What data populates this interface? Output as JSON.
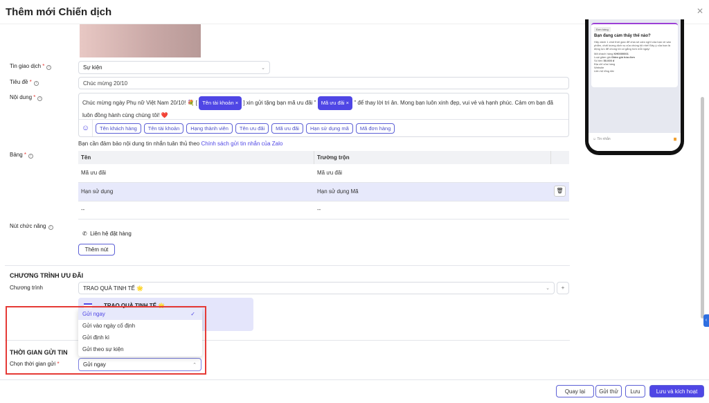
{
  "title": "Thêm mới Chiến dịch",
  "form": {
    "transaction_label": "Tin giao dịch",
    "transaction_value": "Sự kiện",
    "subject_label": "Tiêu đề",
    "subject_value": "Chúc mừng 20/10",
    "content_label": "Nội dung",
    "content_part1": "Chúc mừng ngày Phụ nữ Việt Nam 20/10! 💐 [",
    "tag_account": "Tên tài khoản",
    "content_part2": "] xin gửi tặng bạn mã ưu đãi \"",
    "tag_code": "Mã ưu đãi",
    "content_part3": "\" để thay lời tri ân. Mong bạn luôn xinh đẹp, vui vẻ và hạnh phúc. Cảm ơn bạn đã luôn đồng hành cùng chúng tôi! ❤️",
    "chips": [
      "Tên khách hàng",
      "Tên tài khoản",
      "Hạng thành viên",
      "Tên ưu đãi",
      "Mã ưu đãi",
      "Hạn sử dụng mã",
      "Mã đơn hàng"
    ],
    "note": "Bạn cần đảm bảo nội dung tin nhắn tuân thủ theo ",
    "note_link": "Chính sách gửi tin nhắn của Zalo",
    "table_label": "Bảng",
    "table_headers": [
      "Tên",
      "Trường trộn"
    ],
    "table_rows": [
      [
        "Mã ưu đãi",
        "Mã ưu đãi"
      ],
      [
        "Hạn sử dụng",
        "Hạn sử dụng Mã"
      ],
      [
        "--",
        "--"
      ]
    ],
    "button_label": "Nút chức năng",
    "button_item": "Liên hệ đặt hàng",
    "add_button": "Thêm nút"
  },
  "promo": {
    "heading": "CHƯƠNG TRÌNH ƯU ĐÃI",
    "program_label": "Chương trình",
    "program_value": "TRAO QUÀ TINH TẾ 🌟",
    "card_title": "TRAO QUÀ TINH TẾ 🌟"
  },
  "send_time": {
    "heading": "THỜI GIAN GỬI TIN",
    "label": "Chọn thời gian gửi",
    "value": "Gửi ngay",
    "options": [
      "Gửi ngay",
      "Gửi vào ngày cố định",
      "Gửi định kì",
      "Gửi theo sự kiện"
    ]
  },
  "preview": {
    "badge": "Đơn hàng",
    "title": "Bạn đang cảm thấy thế nào?",
    "body": "Hãy dành 1 chút thời gian để chia sẻ cảm nghĩ của bạn về sản phẩm, chất lượng dịch vụ của chúng tôi nhé! Đây ý của bạn là động lực để chúng tôi cố gắng hơn mỗi ngày!",
    "rows": [
      [
        "Mã khách hàng",
        "KH0000001"
      ],
      [
        "Loại giảm giá",
        "Giảm giá hóa đơn"
      ],
      [
        "Số tiền",
        "50.000 đ"
      ]
    ],
    "links": [
      "Địa chỉ cửa hàng",
      "Website",
      "Liên hệ tổng đài"
    ],
    "input": "Tin nhắn"
  },
  "footer": {
    "back": "Quay lại",
    "test": "Gửi thử",
    "save": "Lưu",
    "save_activate": "Lưu và kích hoạt"
  },
  "colors": {
    "accent": "#4f46e5",
    "highlight": "#e7e9fb",
    "danger": "#e53935"
  }
}
